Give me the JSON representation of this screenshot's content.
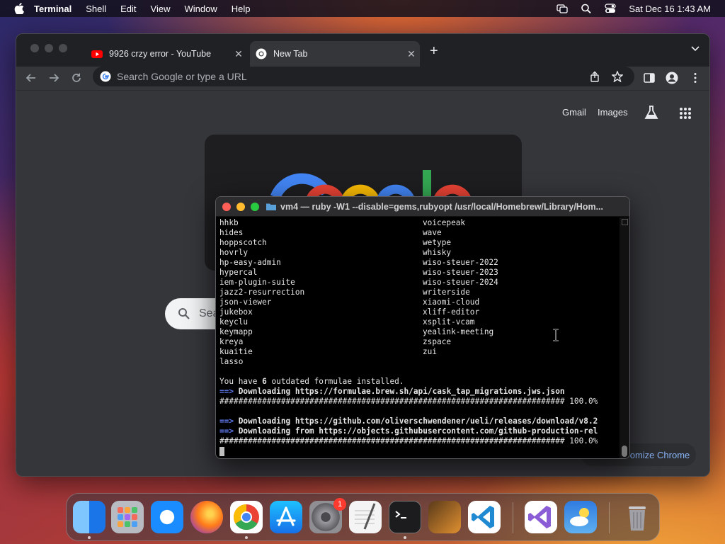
{
  "menubar": {
    "app_name": "Terminal",
    "items": [
      "Shell",
      "Edit",
      "View",
      "Window",
      "Help"
    ],
    "clock": "Sat Dec 16  1:43 AM"
  },
  "chrome": {
    "tabs": [
      {
        "title": "9926 crzy error - YouTube",
        "favicon": "youtube-icon"
      },
      {
        "title": "New Tab",
        "favicon": "chrome-icon"
      }
    ],
    "omnibox_placeholder": "Search Google or type a URL",
    "links": {
      "gmail": "Gmail",
      "images": "Images"
    },
    "search_placeholder": "Search Google or type a URL",
    "customize_label": "Customize Chrome",
    "customize_visible": "omize Chrome"
  },
  "terminal": {
    "title": "vm4 — ruby -W1 --disable=gems,rubyopt /usr/local/Homebrew/Library/Hom...",
    "col_a": [
      "hhkb",
      "hides",
      "hoppscotch",
      "hovrly",
      "hp-easy-admin",
      "hypercal",
      "iem-plugin-suite",
      "jazz2-resurrection",
      "json-viewer",
      "jukebox",
      "keyclu",
      "keymapp",
      "kreya",
      "kuaitie",
      "lasso"
    ],
    "col_b": [
      "voicepeak",
      "wave",
      "wetype",
      "whisky",
      "wiso-steuer-2022",
      "wiso-steuer-2023",
      "wiso-steuer-2024",
      "writerside",
      "xiaomi-cloud",
      "xliff-editor",
      "xsplit-vcam",
      "yealink-meeting",
      "zspace",
      "zui"
    ],
    "outdated_prefix": "You have ",
    "outdated_count": "6",
    "outdated_suffix": " outdated formulae installed.",
    "arrow": "==>",
    "line_dl1": " Downloading https://formulae.brew.sh/api/cask_tap_migrations.jws.json",
    "progress1": "######################################################################### 100.0%",
    "line_dl2": " Downloading https://github.com/oliverschwendener/ueli/releases/download/v8.2",
    "line_dl3": " Downloading from https://objects.githubusercontent.com/github-production-rel",
    "progress2": "######################################################################### 100.0%"
  },
  "dock": {
    "apps": [
      {
        "name": "Finder",
        "color": "#1e90ff"
      },
      {
        "name": "Launchpad",
        "color": "#8e8e93"
      },
      {
        "name": "Safari",
        "color": "#1a8cff"
      },
      {
        "name": "Firefox",
        "color": "#ff7a1a"
      },
      {
        "name": "Google Chrome",
        "color": "#ffffff"
      },
      {
        "name": "App Store",
        "color": "#1c8cf5"
      },
      {
        "name": "System Settings",
        "color": "#8e8e93"
      },
      {
        "name": "TextEdit",
        "color": "#f0f0f0"
      },
      {
        "name": "Terminal",
        "color": "#1c1c1e"
      },
      {
        "name": "GarageBand",
        "color": "#3a2a1a"
      },
      {
        "name": "Visual Studio Code",
        "color": "#ffffff"
      },
      {
        "name": "Visual Studio",
        "color": "#ffffff"
      },
      {
        "name": "Weather",
        "color": "#3a8ee6"
      },
      {
        "name": "Trash",
        "color": "#7a7a7e"
      }
    ],
    "settings_badge": "1"
  }
}
